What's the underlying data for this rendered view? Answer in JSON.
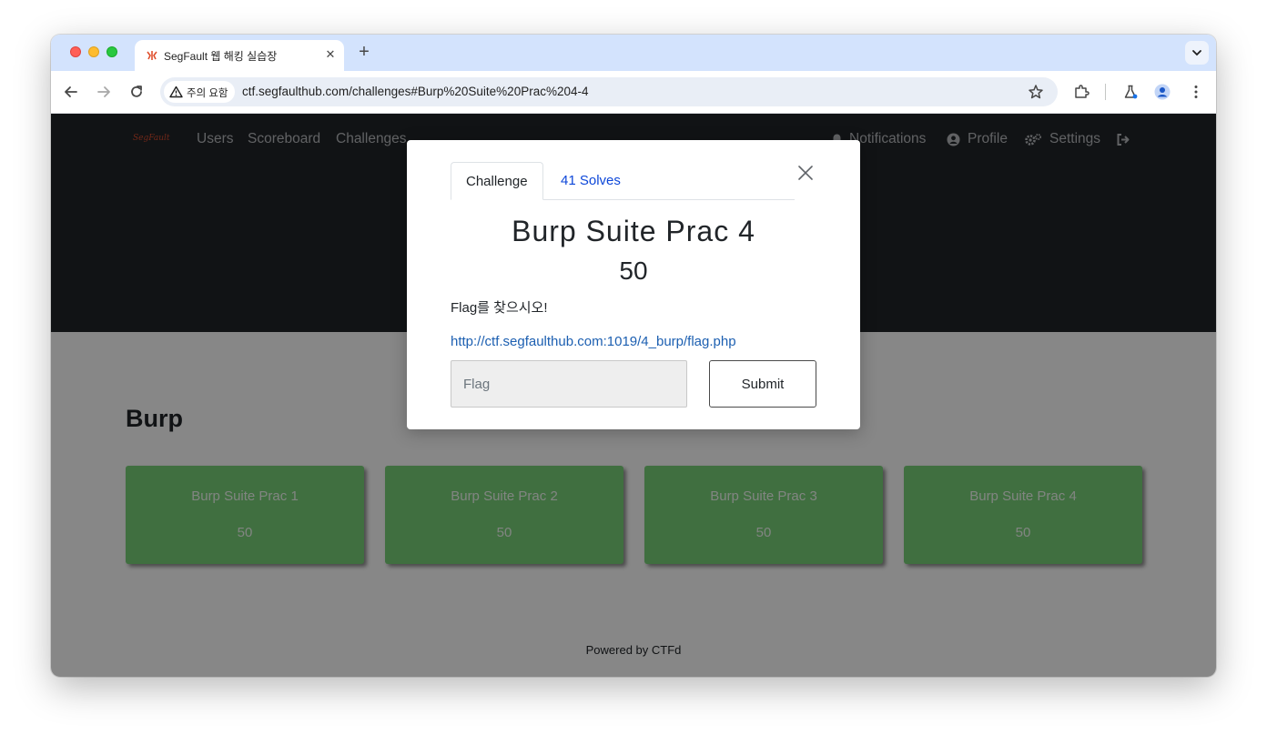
{
  "browser": {
    "tab_title": "SegFault 웹 해킹 실습장",
    "tab_close_glyph": "✕",
    "new_tab_glyph": "+",
    "security_chip": "주의 요함",
    "url": "ctf.segfaulthub.com/challenges#Burp%20Suite%20Prac%204-4"
  },
  "navbar": {
    "brand": "SegFault",
    "left_links": [
      "Users",
      "Scoreboard",
      "Challenges"
    ],
    "right_links": [
      "Notifications",
      "Profile",
      "Settings"
    ]
  },
  "category": {
    "title": "Burp",
    "cards": [
      {
        "name": "Burp Suite Prac 1",
        "value": "50"
      },
      {
        "name": "Burp Suite Prac 2",
        "value": "50"
      },
      {
        "name": "Burp Suite Prac 3",
        "value": "50"
      },
      {
        "name": "Burp Suite Prac 4",
        "value": "50"
      }
    ],
    "card_color": "#7ad17a"
  },
  "footer": "Powered by CTFd",
  "modal": {
    "tabs": [
      "Challenge",
      "41 Solves"
    ],
    "name": "Burp Suite Prac 4",
    "value": "50",
    "description": "Flag를 찾으시오!",
    "link": "http://ctf.segfaulthub.com:1019/4_burp/flag.php",
    "flag_placeholder": "Flag",
    "submit_label": "Submit"
  }
}
